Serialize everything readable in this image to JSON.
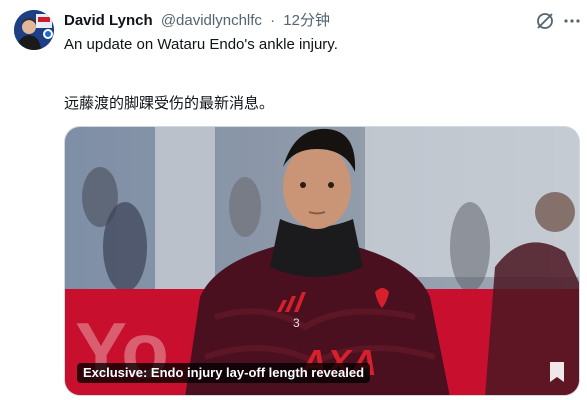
{
  "author": {
    "display_name": "David Lynch",
    "handle": "@davidlynchlfc",
    "separator": "·",
    "time": "12分钟"
  },
  "icons": {
    "avatar": "profile-avatar",
    "grok": "grok-slash-circle-icon",
    "more": "more-dots-icon",
    "bookmark": "bookmark-icon"
  },
  "post": {
    "text_en": "An update on Wataru Endo's ankle injury.",
    "text_zh": "远藤渡的脚踝受伤的最新消息。"
  },
  "card": {
    "caption": "Exclusive: Endo injury lay-off length revealed",
    "shirt_sponsor": "AXA",
    "shirt_number": "3",
    "board_text": "Yo"
  },
  "colors": {
    "text_primary": "#0f1419",
    "text_secondary": "#536471",
    "kit_maroon": "#4a1020",
    "board_red": "#c8102e"
  }
}
